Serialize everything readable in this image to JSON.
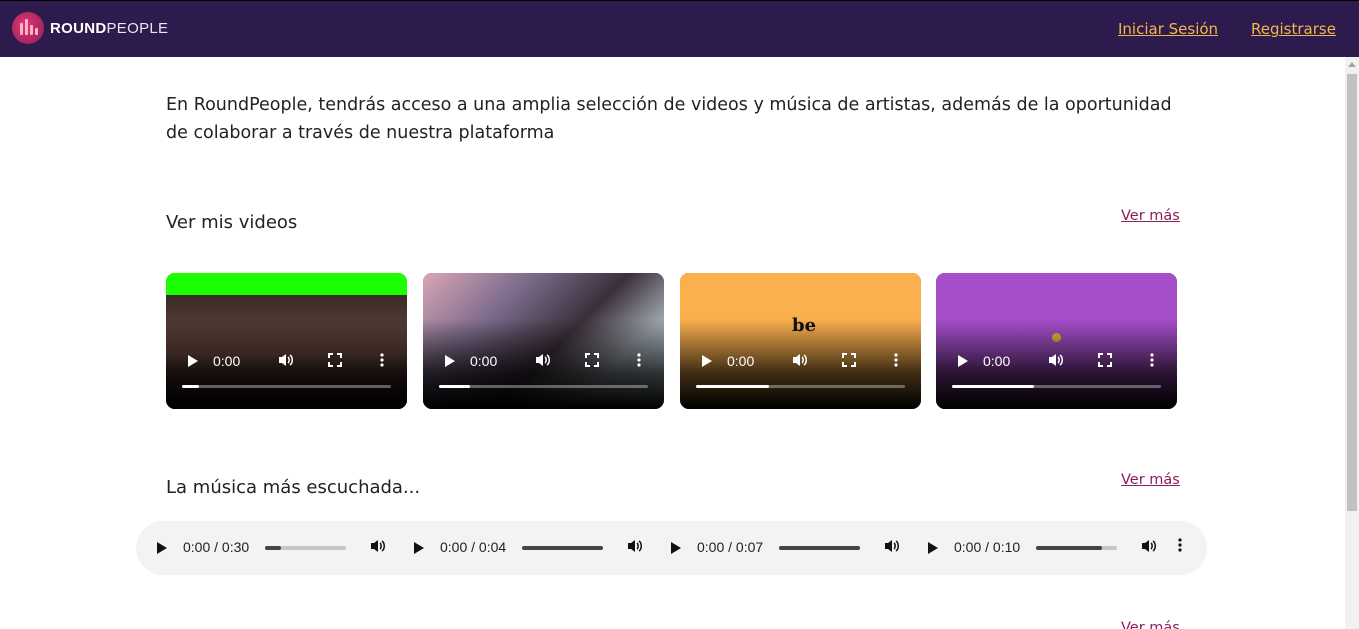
{
  "header": {
    "brand_bold": "ROUND",
    "brand_light": "PEOPLE",
    "login": "Iniciar Sesión",
    "register": "Registrarse"
  },
  "intro": "En RoundPeople, tendrás acceso a una amplia selección de videos y música de artistas, además de la oportunidad de colaborar a través de nuestra plataforma",
  "videos_section": {
    "title": "Ver mis videos",
    "more": "Ver más",
    "videos": [
      {
        "time": "0:00",
        "progress": 0.08
      },
      {
        "time": "0:00",
        "progress": 0.15
      },
      {
        "time": "0:00",
        "progress": 0.35,
        "overlay_text": "be"
      },
      {
        "time": "0:00",
        "progress": 0.39
      }
    ]
  },
  "music_section": {
    "title": "La música más escuchada...",
    "more": "Ver más",
    "tracks": [
      {
        "time": "0:00 / 0:30",
        "progress": 0.2
      },
      {
        "time": "0:00 / 0:04",
        "progress": 1.0
      },
      {
        "time": "0:00 / 0:07",
        "progress": 1.0
      },
      {
        "time": "0:00 / 0:10",
        "progress": 0.82
      }
    ]
  },
  "next_section": {
    "more": "Ver más"
  },
  "colors": {
    "header_bg": "#2d1b4e",
    "nav_link": "#f5b54a",
    "accent_link": "#8e1f5c",
    "player_bg": "#f1f3f4"
  },
  "icons": {
    "logo": "roundpeople-logo-icon",
    "play": "play-icon",
    "volume": "volume-icon",
    "fullscreen": "fullscreen-icon",
    "more": "more-vertical-icon"
  }
}
